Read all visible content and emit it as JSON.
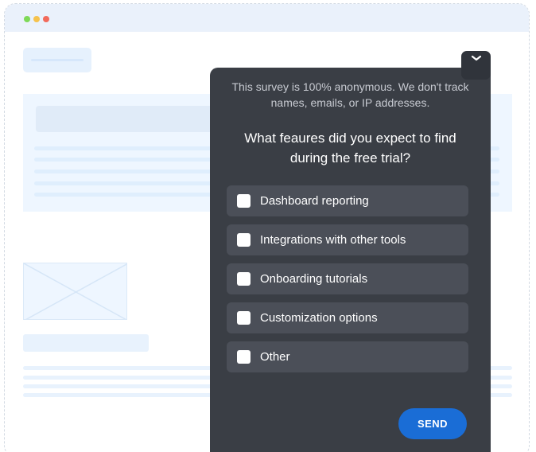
{
  "survey": {
    "anonymity_note": "This survey is 100% anonymous. We don't track names, emails, or IP addresses.",
    "question": "What feaures did you expect to find during the free trial?",
    "options": [
      {
        "label": "Dashboard reporting",
        "checked": false
      },
      {
        "label": "Integrations with other tools",
        "checked": false
      },
      {
        "label": "Onboarding tutorials",
        "checked": false
      },
      {
        "label": "Customization options",
        "checked": false
      },
      {
        "label": "Other",
        "checked": false
      }
    ],
    "send_label": "SEND",
    "collapse_icon": "chevron-down-icon"
  },
  "colors": {
    "panel_bg": "#3a3e45",
    "option_bg": "#4b4f58",
    "send_button": "#1a6dd6",
    "window_dots": [
      "#7ed957",
      "#f6c24c",
      "#f26a5b"
    ]
  }
}
